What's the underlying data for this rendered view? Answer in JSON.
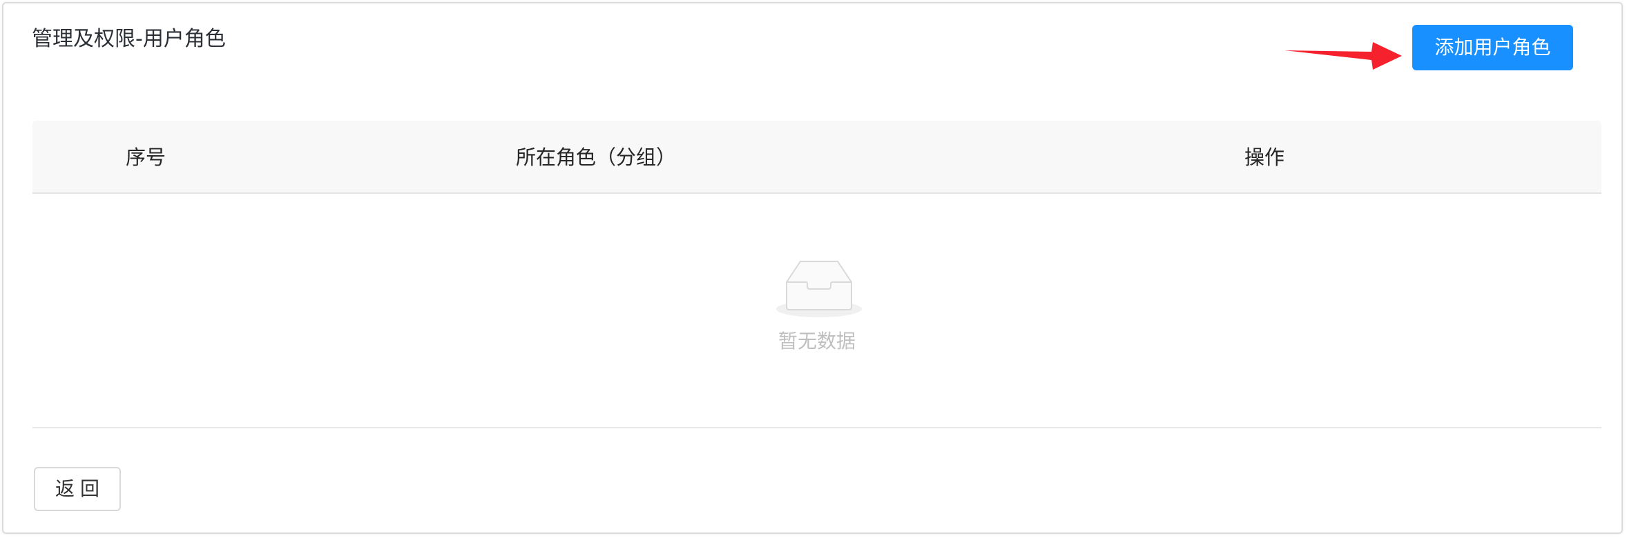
{
  "page": {
    "title": "管理及权限-用户角色"
  },
  "toolbar": {
    "add_role_label": "添加用户角色"
  },
  "table": {
    "columns": [
      "序号",
      "所在角色（分组）",
      "操作"
    ],
    "rows": [],
    "empty_text": "暂无数据"
  },
  "footer": {
    "back_label": "返回"
  },
  "colors": {
    "primary": "#1890ff",
    "annotation_arrow": "#f5222d",
    "header_bg": "#f8f8f8",
    "empty_text": "#bfbfbf"
  },
  "icons": {
    "empty": "empty-inbox-icon",
    "annotation": "arrow-right-icon"
  }
}
